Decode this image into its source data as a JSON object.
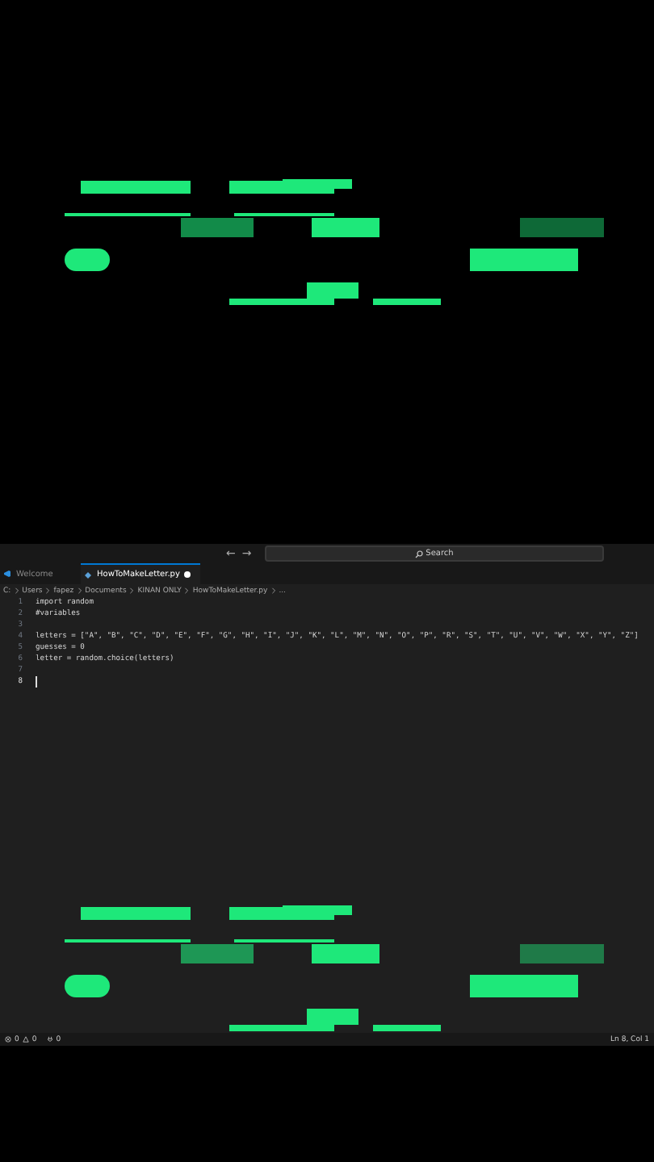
{
  "title_bar": {
    "back": "←",
    "forward": "→",
    "search": "Search"
  },
  "tabs": [
    {
      "label": "Welcome",
      "selected": false,
      "modified": false
    },
    {
      "label": "HowToMakeLetter.py",
      "selected": true,
      "modified": true
    }
  ],
  "breadcrumb": [
    "C:",
    "Users",
    "fapez",
    "Documents",
    "KINAN ONLY",
    "HowToMakeLetter.py",
    "..."
  ],
  "code_lines": [
    {
      "number": "1",
      "text": "import random",
      "current": false
    },
    {
      "number": "2",
      "text": "#variables",
      "current": false
    },
    {
      "number": "3",
      "current": false
    },
    {
      "number": "4",
      "text": "letters = [\"A\", \"B\", \"C\", \"D\", \"E\", \"F\", \"G\", \"H\", \"I\", \"J\", \"K\", \"L\", \"M\", \"N\", \"O\", \"P\", \"R\", \"S\", \"T\", \"U\", \"V\", \"W\", \"X\", \"Y\", \"Z\"]",
      "current": false
    },
    {
      "number": "5",
      "text": "guesses = 0",
      "current": false
    },
    {
      "number": "6",
      "text": "letter = random.choice(letters)",
      "current": false
    },
    {
      "number": "7",
      "current": false
    },
    {
      "number": "8",
      "current": true
    }
  ],
  "status_bar": {
    "errors": "0",
    "warnings": "0",
    "ports": "0",
    "position": "Ln 8, Col 1"
  }
}
